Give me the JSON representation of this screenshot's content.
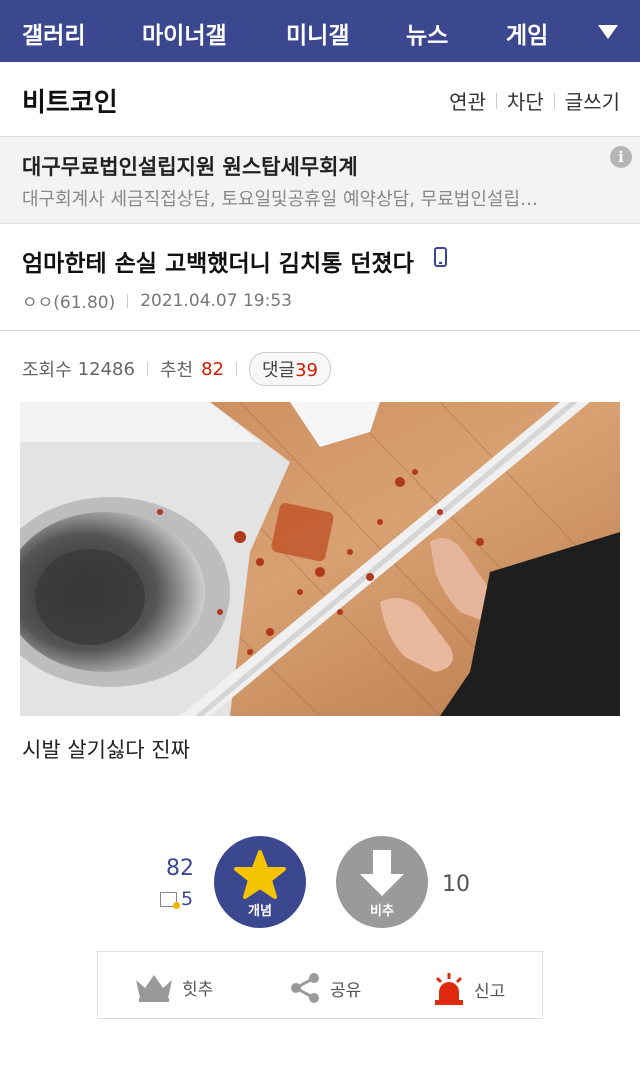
{
  "nav": {
    "items": [
      "갤러리",
      "마이너갤",
      "미니갤",
      "뉴스",
      "게임"
    ]
  },
  "gallery": {
    "name": "비트코인",
    "links": [
      "연관",
      "차단",
      "글쓰기"
    ]
  },
  "ad": {
    "title": "대구무료법인설립지원 원스탑세무회계",
    "description": "대구회계사 세금직접상담, 토요일및공휴일 예약상담, 무료법인설립…",
    "info_icon": "i"
  },
  "post": {
    "title": "엄마한테 손실 고백했더니 김치통 던졌다",
    "author": "ㅇㅇ(61.80)",
    "date": "2021.04.07 19:53",
    "views_label": "조회수",
    "views": "12486",
    "recommend_label": "추천",
    "recommend": "82",
    "comments_label": "댓글",
    "comments": "39",
    "body": "시발 살기싫다 진짜"
  },
  "vote": {
    "up_count": "82",
    "fixed_count": "5",
    "up_label": "개념",
    "down_label": "비추",
    "down_count": "10"
  },
  "actions": {
    "hit": "힛추",
    "share": "공유",
    "report": "신고"
  },
  "colors": {
    "nav_bg": "#3b4890",
    "up_button": "#3b4890",
    "down_button": "#9a9a9a",
    "accent_red": "#d31900",
    "star": "#f5c400"
  }
}
